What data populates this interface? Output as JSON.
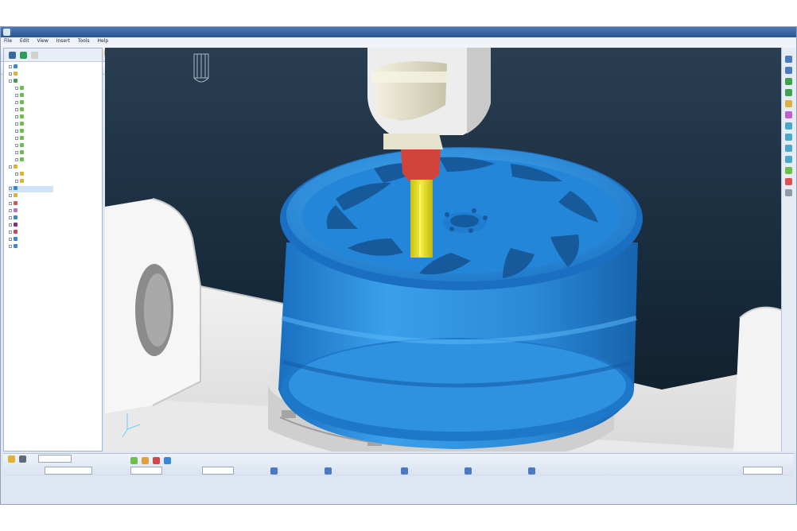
{
  "window": {
    "title": "",
    "menu": [
      "File",
      "Edit",
      "View",
      "Insert",
      "Tools",
      "Help"
    ]
  },
  "toolbar": {
    "dropdown_1": "",
    "dropdown_2": "",
    "dropdown_3": ""
  },
  "colors": {
    "wheel": "#2a8fe0",
    "tool_shank": "#e6df1f",
    "tool_holder": "#d2443a",
    "spindle": "#e8e5cf",
    "background_dark": "#12202d",
    "machine_table": "#ececec"
  },
  "icons": [
    "folder-icon",
    "cam-icon",
    "tool-icon",
    "toolpath-icon",
    "model-icon",
    "view-icon",
    "zoom-icon",
    "settings-icon"
  ],
  "status": {
    "fields": [
      "",
      "",
      "",
      "",
      ""
    ]
  }
}
